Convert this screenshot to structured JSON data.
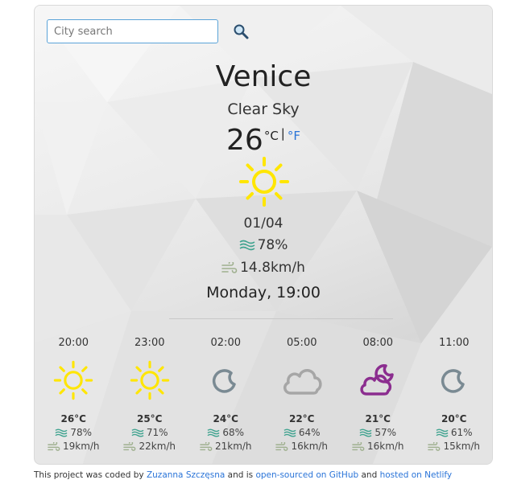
{
  "search": {
    "placeholder": "City search"
  },
  "current": {
    "city": "Venice",
    "description": "Clear Sky",
    "temperature": "26",
    "unit_c": "°C",
    "unit_sep": "|",
    "unit_f": "°F",
    "date": "01/04",
    "humidity": "78%",
    "wind": "14.8km/h",
    "datetime": "Monday, 19:00",
    "icon": "sun-icon"
  },
  "forecast": [
    {
      "hour": "20:00",
      "icon": "sun-icon",
      "temp": "26°C",
      "humidity": "78%",
      "wind": "19km/h"
    },
    {
      "hour": "23:00",
      "icon": "sun-icon",
      "temp": "25°C",
      "humidity": "71%",
      "wind": "22km/h"
    },
    {
      "hour": "02:00",
      "icon": "moon-icon",
      "temp": "24°C",
      "humidity": "68%",
      "wind": "21km/h"
    },
    {
      "hour": "05:00",
      "icon": "cloud-icon",
      "temp": "22°C",
      "humidity": "64%",
      "wind": "16km/h"
    },
    {
      "hour": "08:00",
      "icon": "moon-cloud-icon",
      "temp": "21°C",
      "humidity": "57%",
      "wind": "16km/h"
    },
    {
      "hour": "11:00",
      "icon": "moon-icon",
      "temp": "20°C",
      "humidity": "61%",
      "wind": "15km/h"
    }
  ],
  "footer": {
    "prefix": "This project was coded by ",
    "author": "Zuzanna Szczęsna",
    "middle": " and is ",
    "github": "open-sourced on GitHub",
    "and": " and ",
    "netlify": "hosted on Netlify"
  },
  "colors": {
    "sun": "#ffe600",
    "moon": "#7a8a93",
    "cloud": "#a6a6a6",
    "purple": "#8b2d8f",
    "link": "#2a74d8",
    "humidity_icon": "#3fa38f",
    "wind_icon": "#9fb08f"
  }
}
